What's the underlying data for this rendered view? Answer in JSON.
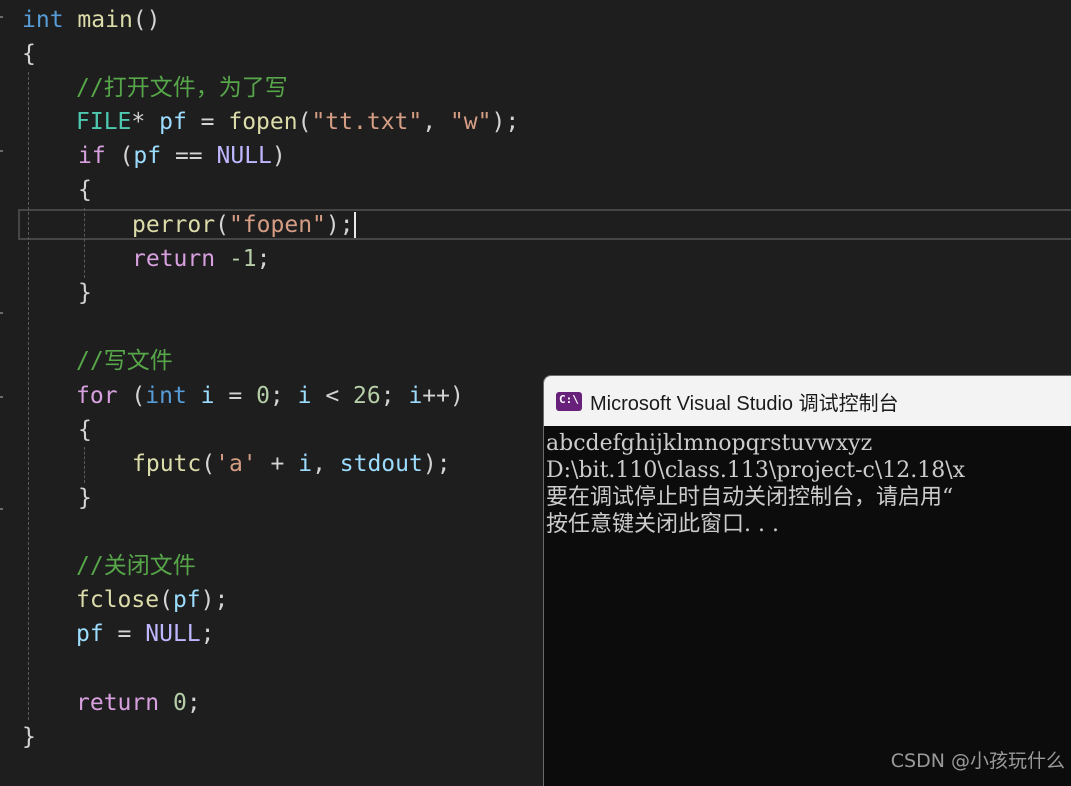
{
  "colors": {
    "editor_bg": "#1e1e1e",
    "keyword": "#569cd6",
    "control": "#d8a0df",
    "function": "#dcdcaa",
    "type": "#4ec9b0",
    "variable": "#9cdcfe",
    "macro": "#beb7ff",
    "string": "#d69d85",
    "number": "#b5cea8",
    "comment": "#57a64a",
    "punctuation": "#d4d4d4",
    "console_bg": "#0c0c0c",
    "console_text": "#cccccc"
  },
  "editor": {
    "lines": [
      [
        {
          "t": "int",
          "c": "keyword"
        },
        {
          "t": " ",
          "c": "punctuation"
        },
        {
          "t": "main",
          "c": "function"
        },
        {
          "t": "()",
          "c": "punctuation"
        }
      ],
      [
        {
          "t": "{",
          "c": "punctuation"
        }
      ],
      [
        {
          "t": "//打开文件，为了写",
          "c": "comment"
        }
      ],
      [
        {
          "t": "FILE",
          "c": "type"
        },
        {
          "t": "* ",
          "c": "punctuation"
        },
        {
          "t": "pf",
          "c": "variable"
        },
        {
          "t": " = ",
          "c": "punctuation"
        },
        {
          "t": "fopen",
          "c": "function"
        },
        {
          "t": "(",
          "c": "punctuation"
        },
        {
          "t": "\"tt.txt\"",
          "c": "string"
        },
        {
          "t": ", ",
          "c": "punctuation"
        },
        {
          "t": "\"w\"",
          "c": "string"
        },
        {
          "t": ");",
          "c": "punctuation"
        }
      ],
      [
        {
          "t": "if",
          "c": "control"
        },
        {
          "t": " (",
          "c": "punctuation"
        },
        {
          "t": "pf",
          "c": "variable"
        },
        {
          "t": " == ",
          "c": "punctuation"
        },
        {
          "t": "NULL",
          "c": "macro"
        },
        {
          "t": ")",
          "c": "punctuation"
        }
      ],
      [
        {
          "t": "{",
          "c": "punctuation"
        }
      ],
      [
        {
          "t": "perror",
          "c": "function"
        },
        {
          "t": "(",
          "c": "punctuation"
        },
        {
          "t": "\"fopen\"",
          "c": "string"
        },
        {
          "t": ");",
          "c": "punctuation"
        }
      ],
      [
        {
          "t": "return",
          "c": "control"
        },
        {
          "t": " ",
          "c": "punctuation"
        },
        {
          "t": "-1",
          "c": "number"
        },
        {
          "t": ";",
          "c": "punctuation"
        }
      ],
      [
        {
          "t": "}",
          "c": "punctuation"
        }
      ],
      [],
      [
        {
          "t": "//写文件",
          "c": "comment"
        }
      ],
      [
        {
          "t": "for",
          "c": "control"
        },
        {
          "t": " (",
          "c": "punctuation"
        },
        {
          "t": "int",
          "c": "keyword"
        },
        {
          "t": " ",
          "c": "punctuation"
        },
        {
          "t": "i",
          "c": "variable"
        },
        {
          "t": " = ",
          "c": "punctuation"
        },
        {
          "t": "0",
          "c": "number"
        },
        {
          "t": "; ",
          "c": "punctuation"
        },
        {
          "t": "i",
          "c": "variable"
        },
        {
          "t": " < ",
          "c": "punctuation"
        },
        {
          "t": "26",
          "c": "number"
        },
        {
          "t": "; ",
          "c": "punctuation"
        },
        {
          "t": "i",
          "c": "variable"
        },
        {
          "t": "++)",
          "c": "punctuation"
        }
      ],
      [
        {
          "t": "{",
          "c": "punctuation"
        }
      ],
      [
        {
          "t": "fputc",
          "c": "function"
        },
        {
          "t": "(",
          "c": "punctuation"
        },
        {
          "t": "'a'",
          "c": "string"
        },
        {
          "t": " + ",
          "c": "punctuation"
        },
        {
          "t": "i",
          "c": "variable"
        },
        {
          "t": ", ",
          "c": "punctuation"
        },
        {
          "t": "stdout",
          "c": "variable"
        },
        {
          "t": ");",
          "c": "punctuation"
        }
      ],
      [
        {
          "t": "}",
          "c": "punctuation"
        }
      ],
      [],
      [
        {
          "t": "//关闭文件",
          "c": "comment"
        }
      ],
      [
        {
          "t": "fclose",
          "c": "function"
        },
        {
          "t": "(",
          "c": "punctuation"
        },
        {
          "t": "pf",
          "c": "variable"
        },
        {
          "t": ");",
          "c": "punctuation"
        }
      ],
      [
        {
          "t": "pf",
          "c": "variable"
        },
        {
          "t": " = ",
          "c": "punctuation"
        },
        {
          "t": "NULL",
          "c": "macro"
        },
        {
          "t": ";",
          "c": "punctuation"
        }
      ],
      [],
      [
        {
          "t": "return",
          "c": "control"
        },
        {
          "t": " ",
          "c": "punctuation"
        },
        {
          "t": "0",
          "c": "number"
        },
        {
          "t": ";",
          "c": "punctuation"
        }
      ],
      [
        {
          "t": "}",
          "c": "punctuation"
        }
      ]
    ]
  },
  "console": {
    "icon": "vs-console-icon",
    "title": "Microsoft Visual Studio 调试控制台",
    "output_lines": [
      "abcdefghijklmnopqrstuvwxyz",
      "D:\\bit.110\\class.113\\project-c\\12.18\\x",
      "要在调试停止时自动关闭控制台，请启用“",
      "按任意键关闭此窗口. . ."
    ]
  },
  "watermark": {
    "text": "CSDN @小孩玩什么"
  }
}
